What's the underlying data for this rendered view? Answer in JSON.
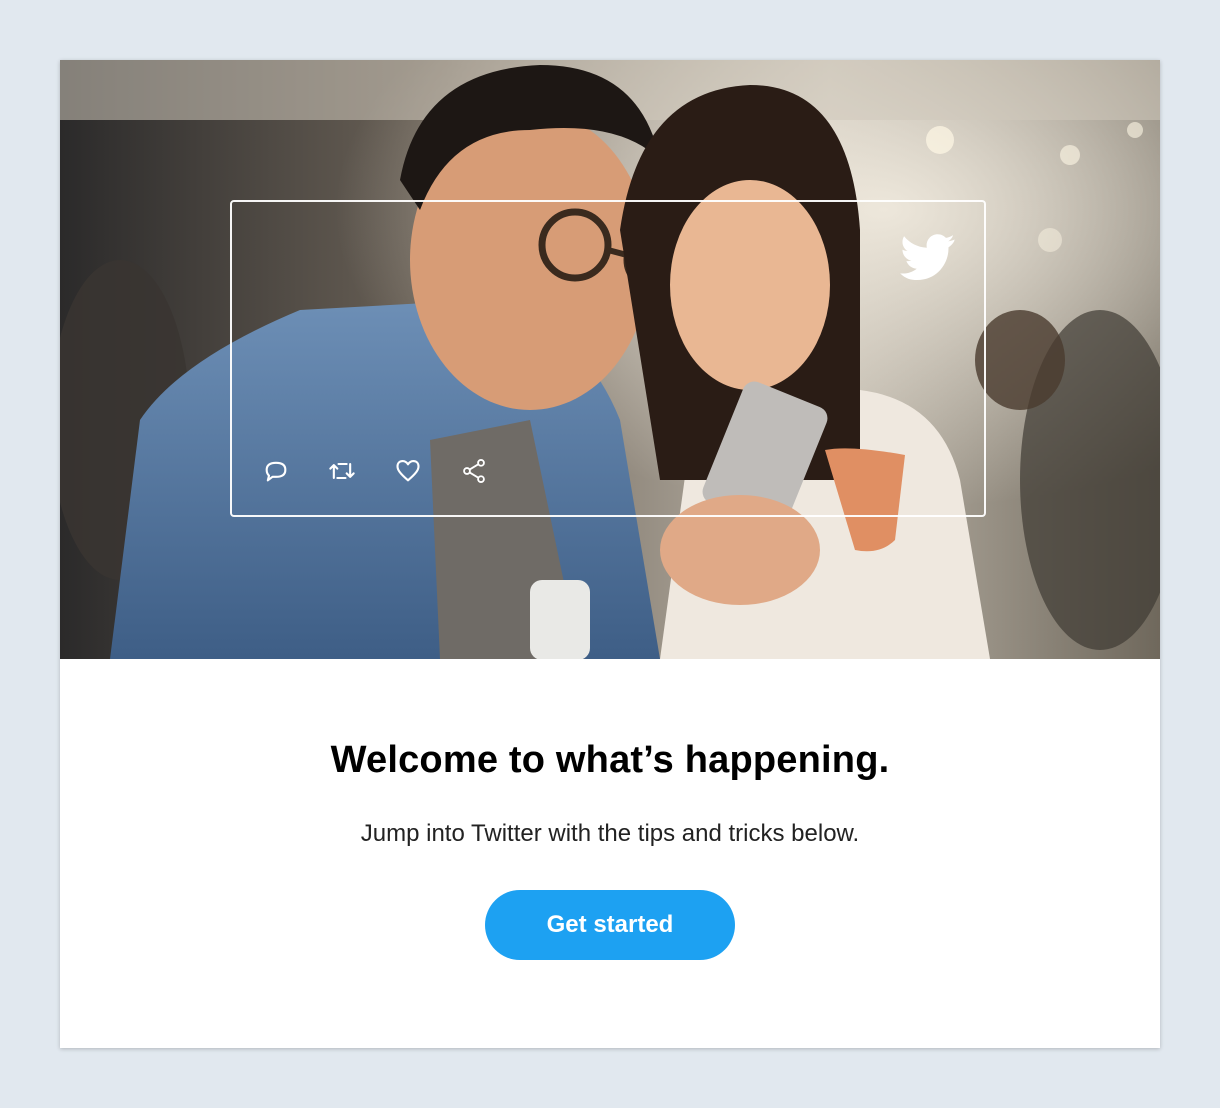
{
  "hero": {
    "image_description": "",
    "frame_icons": [
      "reply-icon",
      "retweet-icon",
      "like-icon",
      "share-icon"
    ],
    "brand_icon": "twitter-bird-icon"
  },
  "main": {
    "headline": "Welcome to what’s happening.",
    "subtext": "Jump into Twitter with the tips and tricks below.",
    "cta_label": "Get started"
  },
  "colors": {
    "page_background": "#e1e8ef",
    "card_background": "#ffffff",
    "accent": "#1da1f2",
    "headline": "#000000",
    "body_text": "#222222"
  }
}
